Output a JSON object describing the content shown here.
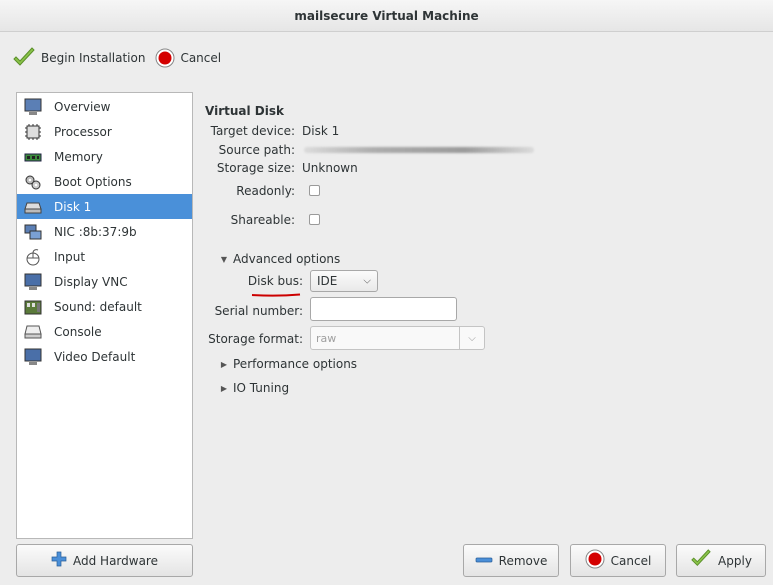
{
  "window": {
    "title": "mailsecure Virtual Machine"
  },
  "toolbar": {
    "begin_label": "Begin Installation",
    "cancel_label": "Cancel"
  },
  "sidebar": {
    "items": [
      {
        "label": "Overview",
        "icon": "overview-icon"
      },
      {
        "label": "Processor",
        "icon": "processor-icon"
      },
      {
        "label": "Memory",
        "icon": "memory-icon"
      },
      {
        "label": "Boot Options",
        "icon": "boot-options-icon"
      },
      {
        "label": "Disk 1",
        "icon": "disk-icon",
        "selected": true
      },
      {
        "label": "NIC :8b:37:9b",
        "icon": "nic-icon"
      },
      {
        "label": "Input",
        "icon": "mouse-icon"
      },
      {
        "label": "Display VNC",
        "icon": "display-icon"
      },
      {
        "label": "Sound: default",
        "icon": "sound-icon"
      },
      {
        "label": "Console",
        "icon": "console-icon"
      },
      {
        "label": "Video Default",
        "icon": "video-icon"
      }
    ],
    "add_hardware_label": "Add Hardware"
  },
  "disk": {
    "heading": "Virtual Disk",
    "target_device_label": "Target device:",
    "target_device_value": "Disk 1",
    "source_path_label": "Source path:",
    "storage_size_label": "Storage size:",
    "storage_size_value": "Unknown",
    "readonly_label": "Readonly:",
    "shareable_label": "Shareable:",
    "advanced_label": "Advanced options",
    "disk_bus_label": "Disk bus:",
    "disk_bus_value": "IDE",
    "serial_label": "Serial number:",
    "serial_value": "",
    "storage_format_label": "Storage format:",
    "storage_format_value": "raw",
    "performance_label": "Performance options",
    "io_tuning_label": "IO Tuning"
  },
  "buttons": {
    "remove_label": "Remove",
    "cancel_label": "Cancel",
    "apply_label": "Apply"
  },
  "colors": {
    "selection": "#4a90d9",
    "annotation": "#cc0000"
  }
}
